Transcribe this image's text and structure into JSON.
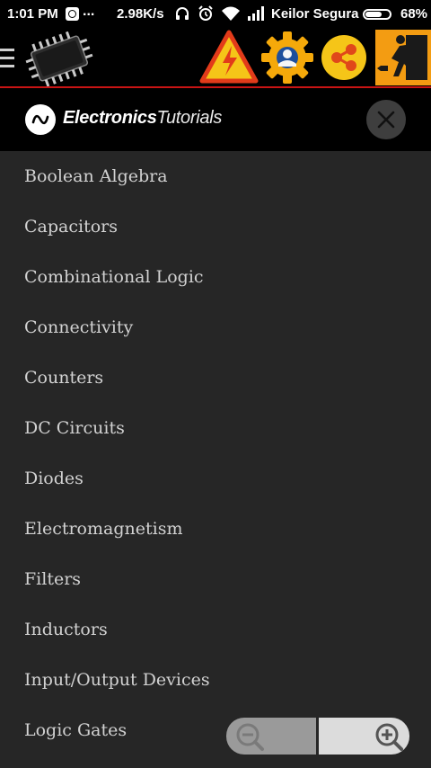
{
  "status_bar": {
    "time": "1:01 PM",
    "overflow": "...",
    "speed": "2.98K/s",
    "carrier": "Keilor Segura",
    "battery_percent": "68%",
    "battery_level": 0.68,
    "icons": [
      "whatsapp-icon",
      "headphones-icon",
      "alarm-icon",
      "wifi-icon",
      "signal-icon",
      "battery-icon"
    ]
  },
  "toolbar": {
    "icons": [
      "menu-icon",
      "microchip-icon",
      "warning-icon",
      "settings-icon",
      "share-icon",
      "exit-icon"
    ],
    "colors": {
      "background": "#000000",
      "accent_line": "#c81414",
      "yellow": "#f5c518",
      "orange": "#ff8c00"
    }
  },
  "drawer": {
    "brand_bold": "Electronics",
    "brand_light": "Tutorials",
    "items": [
      "Boolean Algebra",
      "Capacitors",
      "Combinational Logic",
      "Connectivity",
      "Counters",
      "DC Circuits",
      "Diodes",
      "Electromagnetism",
      "Filters",
      "Inductors",
      "Input/Output Devices",
      "Logic Gates"
    ]
  },
  "zoom": {
    "icons": [
      "zoom-out-icon",
      "zoom-in-icon"
    ]
  }
}
